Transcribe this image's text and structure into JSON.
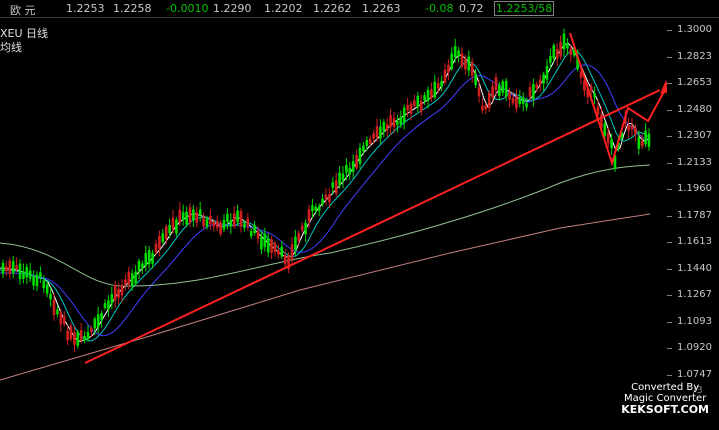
{
  "quote_bar": {
    "name": "欧  元",
    "values": [
      "1.2253",
      "1.2258",
      "-0.0010",
      "1.2290",
      "1.2202",
      "1.2262",
      "1.2263",
      "-0.08",
      "0.72",
      "1.2253/58"
    ]
  },
  "chart": {
    "symbol": "XEU  日线",
    "indicator": "均线"
  },
  "price_axis": {
    "labels": [
      "1.3000",
      "1.2823",
      "1.2653",
      "1.2480",
      "1.2307",
      "1.2133",
      "1.1960",
      "1.1787",
      "1.1613",
      "1.1440",
      "1.1267",
      "1.1093",
      "1.0920",
      "1.0747"
    ]
  },
  "date_partial": "/3",
  "watermark": {
    "line1": "Converted By",
    "line2": "Magic Converter",
    "line3": "KEKSOFT.COM"
  },
  "colors": {
    "up_candle": "#d02020",
    "down_candle": "#00dd00",
    "ma_short": "#ffffff",
    "ma_fast": "#00c8c8",
    "ma_mid": "#4040ff",
    "ma_long": "#90c090",
    "ma_longest": "#c08080",
    "trendline": "#ff2020"
  }
}
